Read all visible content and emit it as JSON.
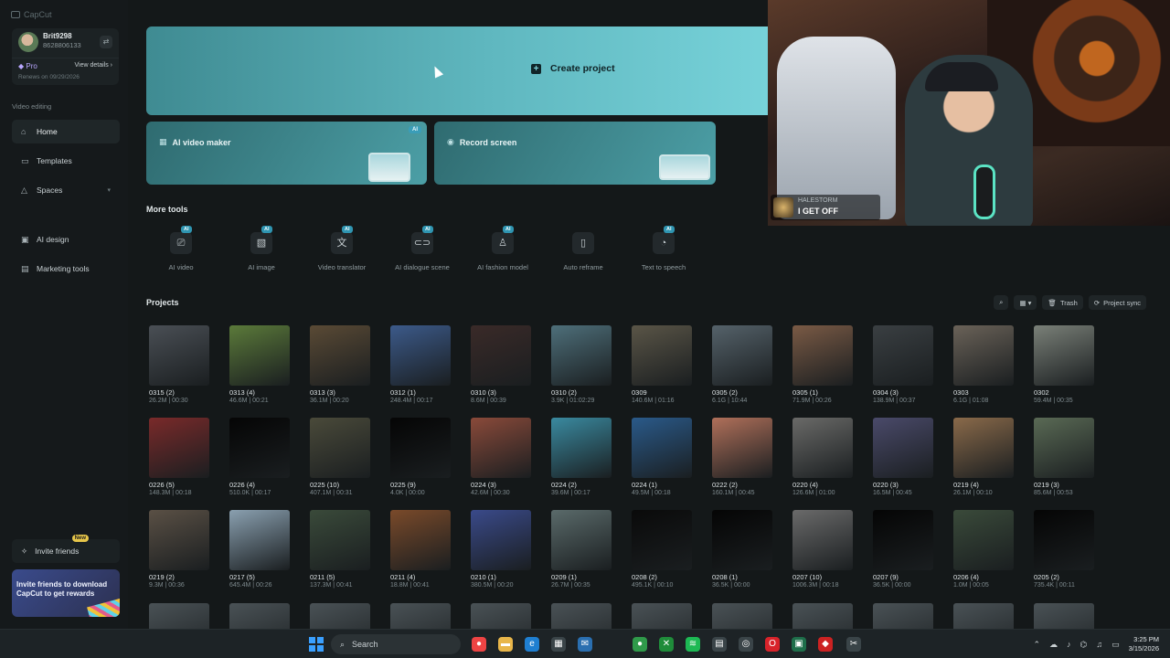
{
  "app": {
    "name": "CapCut"
  },
  "user": {
    "name": "Brit9298",
    "id": "8628806133",
    "plan": "Pro",
    "view_details": "View details",
    "renews": "Renews on 09/29/2026"
  },
  "sidebar": {
    "section_video": "Video editing",
    "items": [
      {
        "label": "Home",
        "icon": "home-icon"
      },
      {
        "label": "Templates",
        "icon": "templates-icon"
      },
      {
        "label": "Spaces",
        "icon": "spaces-icon"
      },
      {
        "label": "AI design",
        "icon": "ai-design-icon"
      },
      {
        "label": "Marketing tools",
        "icon": "marketing-icon"
      }
    ],
    "invite": {
      "label": "Invite friends",
      "badge": "New"
    },
    "promo": "Invite friends to download CapCut to get rewards"
  },
  "main": {
    "create_project": "Create project",
    "ai_video_maker": "AI video maker",
    "ai_tag": "AI",
    "record_screen": "Record screen",
    "more_tools": "More tools",
    "tools": [
      {
        "label": "AI video",
        "glyph": "⎚"
      },
      {
        "label": "AI image",
        "glyph": "▧"
      },
      {
        "label": "Video translator",
        "glyph": "文"
      },
      {
        "label": "AI dialogue scene",
        "glyph": "⊂⊃"
      },
      {
        "label": "AI fashion model",
        "glyph": "♙"
      },
      {
        "label": "Auto reframe",
        "glyph": "▯",
        "no_tag": true
      },
      {
        "label": "Text to speech",
        "glyph": "◔"
      }
    ],
    "projects_label": "Projects",
    "trash": "Trash",
    "project_sync": "Project sync"
  },
  "projects": [
    {
      "name": "0315 (2)",
      "meta": "26.2M | 00:30",
      "color": "#4a4f55"
    },
    {
      "name": "0313 (4)",
      "meta": "46.6M | 00:21",
      "color": "#5b7a3a"
    },
    {
      "name": "0313 (3)",
      "meta": "36.1M | 00:20",
      "color": "#5a4a35"
    },
    {
      "name": "0312 (1)",
      "meta": "248.4M | 00:17",
      "color": "#3c5a8a"
    },
    {
      "name": "0310 (3)",
      "meta": "8.6M | 00:39",
      "color": "#3a2a28"
    },
    {
      "name": "0310 (2)",
      "meta": "3.9K | 01:02:29",
      "color": "#4e6f7a"
    },
    {
      "name": "0309",
      "meta": "140.6M | 01:16",
      "color": "#5a5547"
    },
    {
      "name": "0305 (2)",
      "meta": "6.1G | 10:44",
      "color": "#55626a"
    },
    {
      "name": "0305 (1)",
      "meta": "71.9M | 00:26",
      "color": "#7a5a45"
    },
    {
      "name": "0304 (3)",
      "meta": "138.9M | 00:37",
      "color": "#3a3f42"
    },
    {
      "name": "0303",
      "meta": "6.1G | 01:08",
      "color": "#6a6258"
    },
    {
      "name": "0302",
      "meta": "59.4M | 00:35",
      "color": "#7a8078"
    },
    {
      "name": "0226 (5)",
      "meta": "148.3M | 00:18",
      "color": "#7a2a2a"
    },
    {
      "name": "0226 (4)",
      "meta": "510.0K | 00:17",
      "color": "#050505"
    },
    {
      "name": "0225 (10)",
      "meta": "407.1M | 00:31",
      "color": "#4a4a3a"
    },
    {
      "name": "0225 (9)",
      "meta": "4.0K | 00:00",
      "color": "#050505"
    },
    {
      "name": "0224 (3)",
      "meta": "42.6M | 00:30",
      "color": "#8a4a3a"
    },
    {
      "name": "0224 (2)",
      "meta": "39.6M | 00:17",
      "color": "#3a8aa0"
    },
    {
      "name": "0224 (1)",
      "meta": "49.5M | 00:18",
      "color": "#2a5a8a"
    },
    {
      "name": "0222 (2)",
      "meta": "160.1M | 00:45",
      "color": "#b0705a"
    },
    {
      "name": "0220 (4)",
      "meta": "126.6M | 01:00",
      "color": "#6a6a68"
    },
    {
      "name": "0220 (3)",
      "meta": "16.5M | 00:45",
      "color": "#4a4a6a"
    },
    {
      "name": "0219 (4)",
      "meta": "26.1M | 00:10",
      "color": "#8a6a4a"
    },
    {
      "name": "0219 (3)",
      "meta": "85.6M | 00:53",
      "color": "#5a6a55"
    },
    {
      "name": "0219 (2)",
      "meta": "9.3M | 00:36",
      "color": "#5a5045"
    },
    {
      "name": "0217 (5)",
      "meta": "645.4M | 00:26",
      "color": "#8aa0b0"
    },
    {
      "name": "0211 (5)",
      "meta": "137.3M | 00:41",
      "color": "#3a4a3a"
    },
    {
      "name": "0211 (4)",
      "meta": "18.8M | 00:41",
      "color": "#7a4a2a"
    },
    {
      "name": "0210 (1)",
      "meta": "380.5M | 00:20",
      "color": "#3a4a8a"
    },
    {
      "name": "0209 (1)",
      "meta": "26.7M | 00:35",
      "color": "#5a6a6a"
    },
    {
      "name": "0208 (2)",
      "meta": "495.1K | 00:10",
      "color": "#0a0a0a"
    },
    {
      "name": "0208 (1)",
      "meta": "36.5K | 00:00",
      "color": "#050505"
    },
    {
      "name": "0207 (10)",
      "meta": "1006.3M | 00:18",
      "color": "#6a6a6a"
    },
    {
      "name": "0207 (9)",
      "meta": "36.5K | 00:00",
      "color": "#050505"
    },
    {
      "name": "0206 (4)",
      "meta": "1.0M | 00:05",
      "color": "#3a4a3a"
    },
    {
      "name": "0205 (2)",
      "meta": "735.4K | 00:11",
      "color": "#050505"
    }
  ],
  "webcam": {
    "artist": "HALESTORM",
    "song": "I GET OFF"
  },
  "taskbar": {
    "search_placeholder": "Search",
    "time": "3:25 PM",
    "date": "3/15/2026"
  }
}
